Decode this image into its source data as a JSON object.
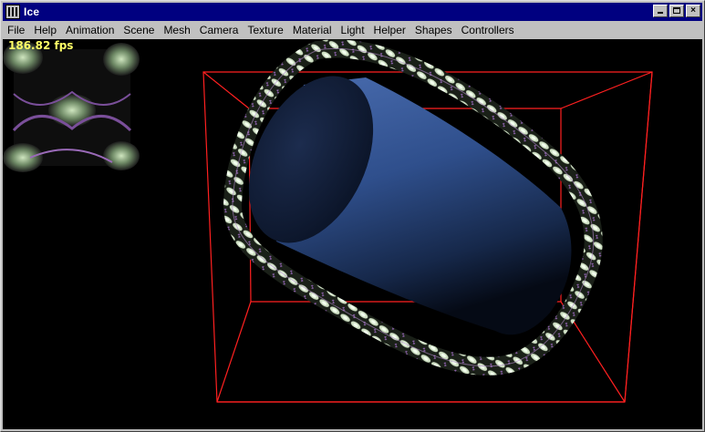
{
  "window": {
    "title": "Ice"
  },
  "menu": {
    "items": [
      "File",
      "Help",
      "Animation",
      "Scene",
      "Mesh",
      "Camera",
      "Texture",
      "Material",
      "Light",
      "Helper",
      "Shapes",
      "Controllers"
    ]
  },
  "viewport": {
    "fps_text": "186.82 fps"
  },
  "colors": {
    "title_bar": "#000080",
    "chrome": "#c0c0c0",
    "fps_text": "#ffff66",
    "bounding_box": "#ff2020",
    "cylinder": "#3a5a9a"
  },
  "icons": {
    "app": "ice-app-icon",
    "minimize": "minimize-icon",
    "maximize": "maximize-icon",
    "close": "close-icon"
  }
}
